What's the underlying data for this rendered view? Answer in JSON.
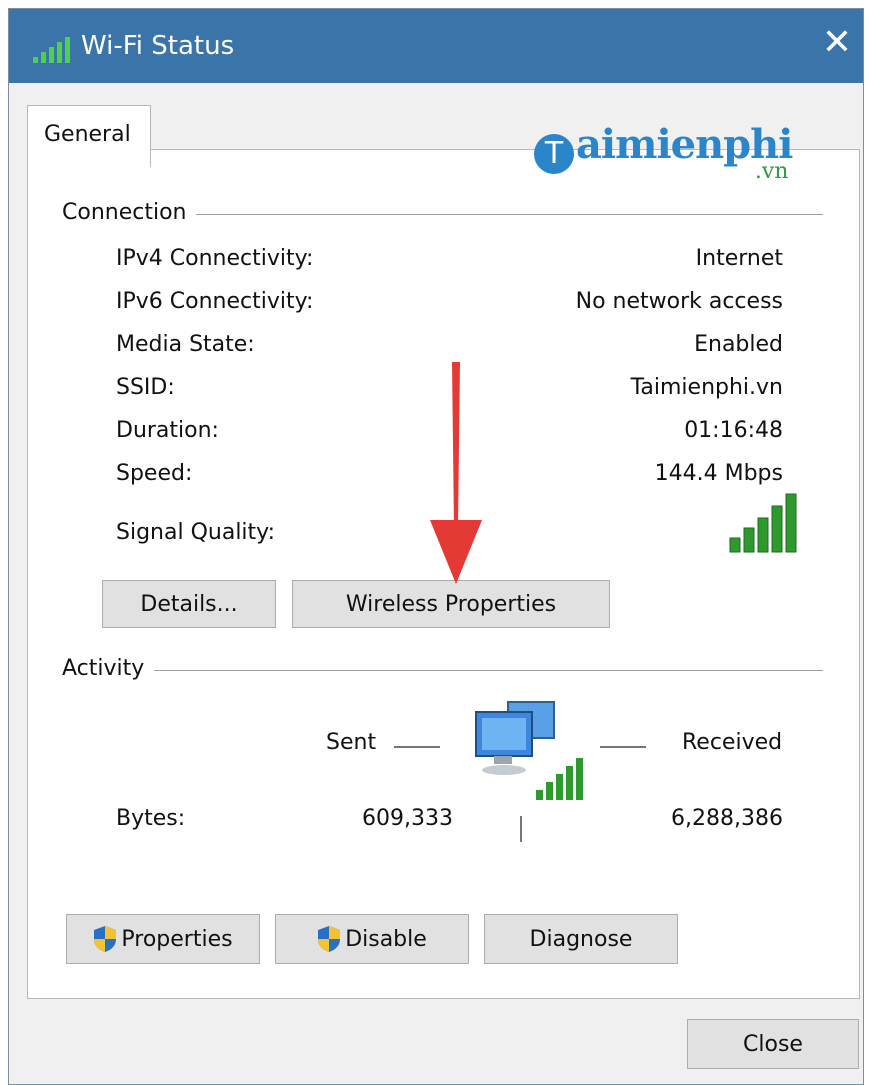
{
  "window": {
    "title": "Wi-Fi Status"
  },
  "tabs": [
    {
      "label": "General"
    }
  ],
  "watermark": {
    "brand_t": "T",
    "brand_rest": "aimienphi",
    "brand_suffix": ".vn"
  },
  "connection": {
    "heading": "Connection",
    "rows": [
      {
        "label": "IPv4 Connectivity:",
        "value": "Internet"
      },
      {
        "label": "IPv6 Connectivity:",
        "value": "No network access"
      },
      {
        "label": "Media State:",
        "value": "Enabled"
      },
      {
        "label": "SSID:",
        "value": "Taimienphi.vn"
      },
      {
        "label": "Duration:",
        "value": "01:16:48"
      },
      {
        "label": "Speed:",
        "value": "144.4 Mbps"
      }
    ],
    "signal_label": "Signal Quality:",
    "signal_bars": 5,
    "details_button": "Details...",
    "wireless_button": "Wireless Properties"
  },
  "activity": {
    "heading": "Activity",
    "sent_label": "Sent",
    "received_label": "Received",
    "bytes_label": "Bytes:",
    "bytes_sent": "609,333",
    "bytes_received": "6,288,386"
  },
  "buttons": {
    "properties": "Properties",
    "disable": "Disable",
    "diagnose": "Diagnose",
    "close": "Close"
  },
  "icons": {
    "title": "wifi-signal-icon",
    "close": "close-icon",
    "signal": "signal-quality-icon",
    "network": "network-computers-icon",
    "shield": "uac-shield-icon",
    "arrow": "red-arrow-annotation"
  },
  "colors": {
    "titlebar": "#3b74a9",
    "signal_green": "#2e9a2e",
    "arrow_red": "#e53935"
  }
}
